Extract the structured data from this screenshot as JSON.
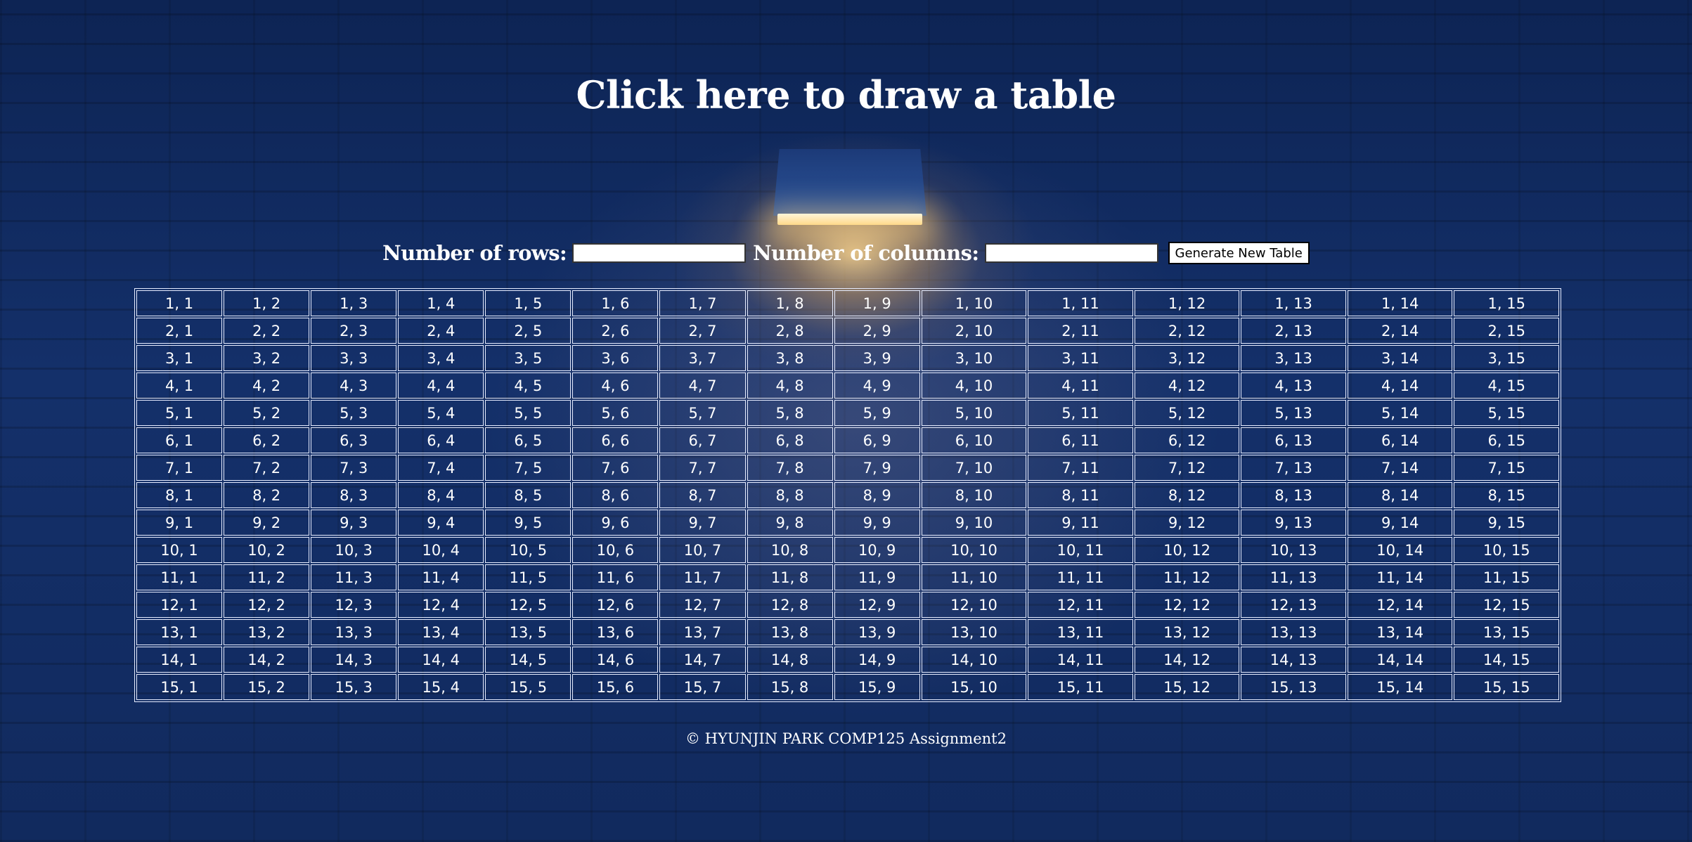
{
  "header": {
    "title": "Click here to draw a table"
  },
  "controls": {
    "rows_label": "Number of rows:",
    "rows_value": "",
    "columns_label": "Number of columns:",
    "columns_value": "",
    "generate_label": "Generate New Table"
  },
  "table": {
    "rows": [
      [
        "1, 1",
        "1, 2",
        "1, 3",
        "1, 4",
        "1, 5",
        "1, 6",
        "1, 7",
        "1, 8",
        "1, 9",
        "1, 10",
        "1, 11",
        "1, 12",
        "1, 13",
        "1, 14",
        "1, 15"
      ],
      [
        "2, 1",
        "2, 2",
        "2, 3",
        "2, 4",
        "2, 5",
        "2, 6",
        "2, 7",
        "2, 8",
        "2, 9",
        "2, 10",
        "2, 11",
        "2, 12",
        "2, 13",
        "2, 14",
        "2, 15"
      ],
      [
        "3, 1",
        "3, 2",
        "3, 3",
        "3, 4",
        "3, 5",
        "3, 6",
        "3, 7",
        "3, 8",
        "3, 9",
        "3, 10",
        "3, 11",
        "3, 12",
        "3, 13",
        "3, 14",
        "3, 15"
      ],
      [
        "4, 1",
        "4, 2",
        "4, 3",
        "4, 4",
        "4, 5",
        "4, 6",
        "4, 7",
        "4, 8",
        "4, 9",
        "4, 10",
        "4, 11",
        "4, 12",
        "4, 13",
        "4, 14",
        "4, 15"
      ],
      [
        "5, 1",
        "5, 2",
        "5, 3",
        "5, 4",
        "5, 5",
        "5, 6",
        "5, 7",
        "5, 8",
        "5, 9",
        "5, 10",
        "5, 11",
        "5, 12",
        "5, 13",
        "5, 14",
        "5, 15"
      ],
      [
        "6, 1",
        "6, 2",
        "6, 3",
        "6, 4",
        "6, 5",
        "6, 6",
        "6, 7",
        "6, 8",
        "6, 9",
        "6, 10",
        "6, 11",
        "6, 12",
        "6, 13",
        "6, 14",
        "6, 15"
      ],
      [
        "7, 1",
        "7, 2",
        "7, 3",
        "7, 4",
        "7, 5",
        "7, 6",
        "7, 7",
        "7, 8",
        "7, 9",
        "7, 10",
        "7, 11",
        "7, 12",
        "7, 13",
        "7, 14",
        "7, 15"
      ],
      [
        "8, 1",
        "8, 2",
        "8, 3",
        "8, 4",
        "8, 5",
        "8, 6",
        "8, 7",
        "8, 8",
        "8, 9",
        "8, 10",
        "8, 11",
        "8, 12",
        "8, 13",
        "8, 14",
        "8, 15"
      ],
      [
        "9, 1",
        "9, 2",
        "9, 3",
        "9, 4",
        "9, 5",
        "9, 6",
        "9, 7",
        "9, 8",
        "9, 9",
        "9, 10",
        "9, 11",
        "9, 12",
        "9, 13",
        "9, 14",
        "9, 15"
      ],
      [
        "10, 1",
        "10, 2",
        "10, 3",
        "10, 4",
        "10, 5",
        "10, 6",
        "10, 7",
        "10, 8",
        "10, 9",
        "10, 10",
        "10, 11",
        "10, 12",
        "10, 13",
        "10, 14",
        "10, 15"
      ],
      [
        "11, 1",
        "11, 2",
        "11, 3",
        "11, 4",
        "11, 5",
        "11, 6",
        "11, 7",
        "11, 8",
        "11, 9",
        "11, 10",
        "11, 11",
        "11, 12",
        "11, 13",
        "11, 14",
        "11, 15"
      ],
      [
        "12, 1",
        "12, 2",
        "12, 3",
        "12, 4",
        "12, 5",
        "12, 6",
        "12, 7",
        "12, 8",
        "12, 9",
        "12, 10",
        "12, 11",
        "12, 12",
        "12, 13",
        "12, 14",
        "12, 15"
      ],
      [
        "13, 1",
        "13, 2",
        "13, 3",
        "13, 4",
        "13, 5",
        "13, 6",
        "13, 7",
        "13, 8",
        "13, 9",
        "13, 10",
        "13, 11",
        "13, 12",
        "13, 13",
        "13, 14",
        "13, 15"
      ],
      [
        "14, 1",
        "14, 2",
        "14, 3",
        "14, 4",
        "14, 5",
        "14, 6",
        "14, 7",
        "14, 8",
        "14, 9",
        "14, 10",
        "14, 11",
        "14, 12",
        "14, 13",
        "14, 14",
        "14, 15"
      ],
      [
        "15, 1",
        "15, 2",
        "15, 3",
        "15, 4",
        "15, 5",
        "15, 6",
        "15, 7",
        "15, 8",
        "15, 9",
        "15, 10",
        "15, 11",
        "15, 12",
        "15, 13",
        "15, 14",
        "15, 15"
      ]
    ]
  },
  "footer": {
    "text": "© HYUNJIN PARK COMP125 Assignment2"
  },
  "theme": {
    "background": "#14306a",
    "text": "#ffffff",
    "lamp_glow": "#ffd98a"
  }
}
